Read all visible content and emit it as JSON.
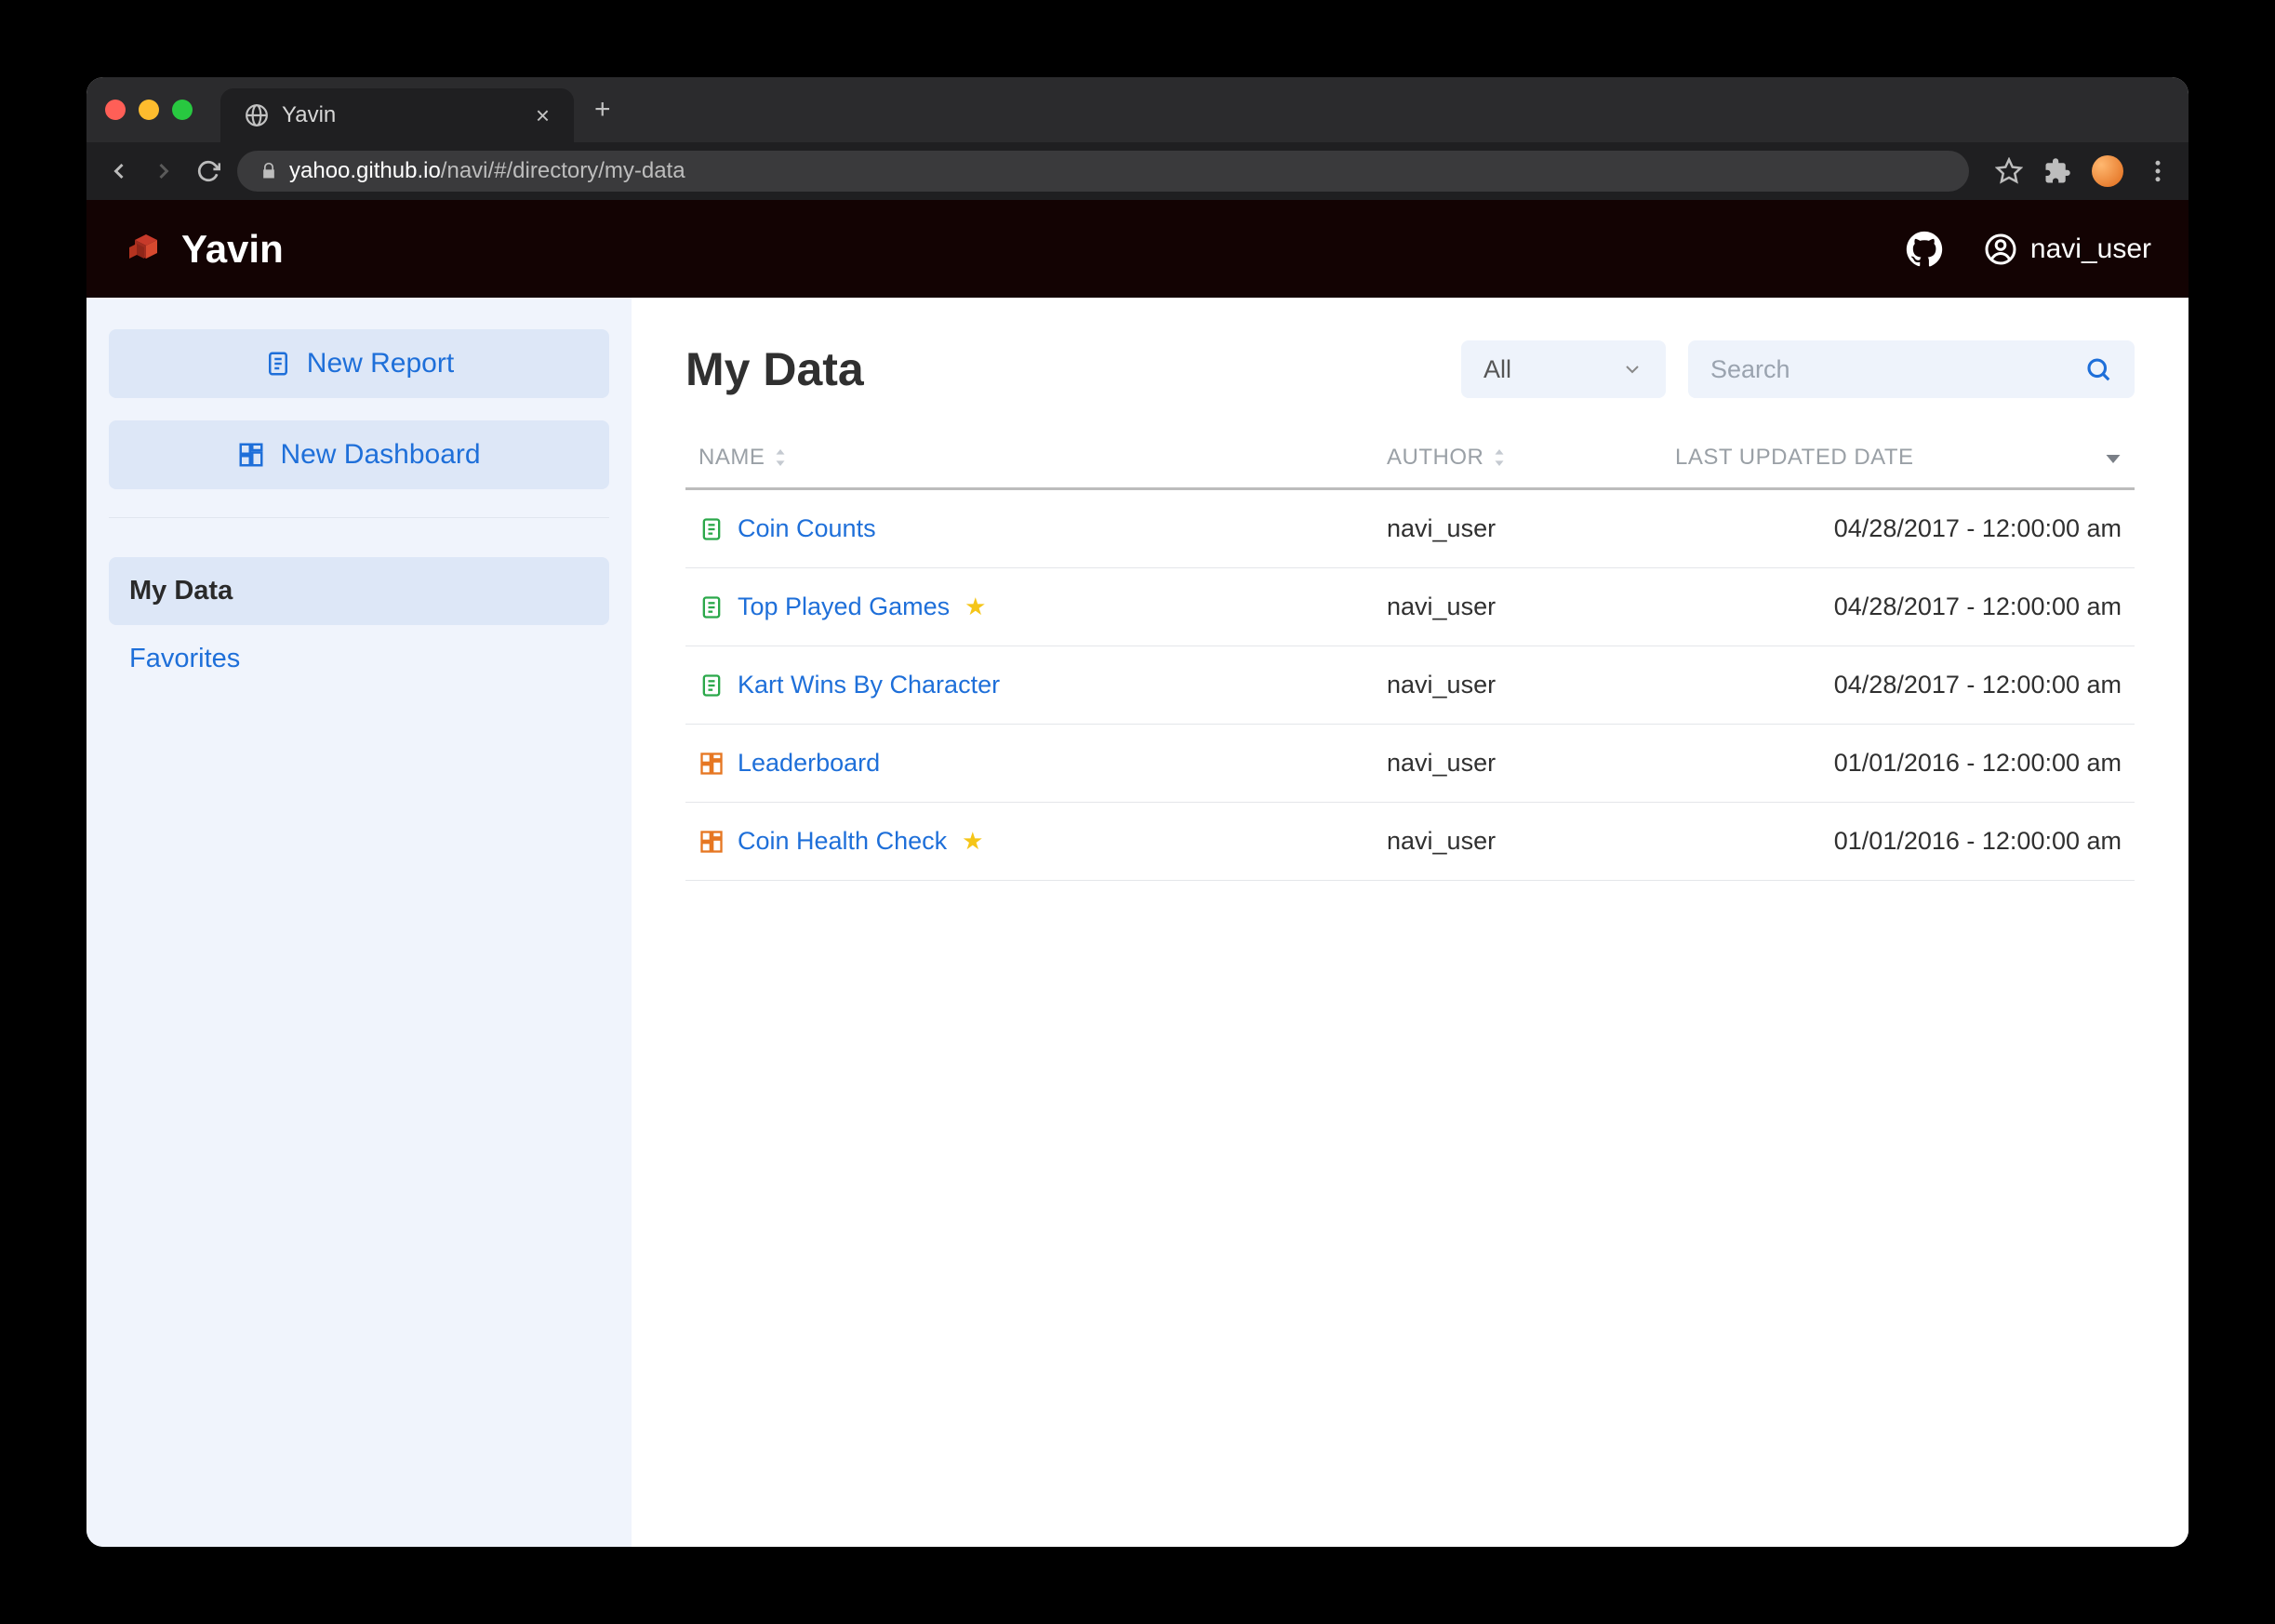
{
  "browser": {
    "tab_title": "Yavin",
    "url_domain": "yahoo.github.io",
    "url_path": "/navi/#/directory/my-data"
  },
  "header": {
    "brand": "Yavin",
    "username": "navi_user"
  },
  "sidebar": {
    "new_report_label": "New Report",
    "new_dashboard_label": "New Dashboard",
    "nav": [
      {
        "label": "My Data",
        "active": true
      },
      {
        "label": "Favorites",
        "active": false
      }
    ]
  },
  "main": {
    "title": "My Data",
    "filter_value": "All",
    "search_placeholder": "Search",
    "columns": {
      "name": "NAME",
      "author": "AUTHOR",
      "updated": "LAST UPDATED DATE"
    },
    "rows": [
      {
        "type": "report",
        "name": "Coin Counts",
        "fav": false,
        "author": "navi_user",
        "updated": "04/28/2017 - 12:00:00 am"
      },
      {
        "type": "report",
        "name": "Top Played Games",
        "fav": true,
        "author": "navi_user",
        "updated": "04/28/2017 - 12:00:00 am"
      },
      {
        "type": "report",
        "name": "Kart Wins By Character",
        "fav": false,
        "author": "navi_user",
        "updated": "04/28/2017 - 12:00:00 am"
      },
      {
        "type": "dashboard",
        "name": "Leaderboard",
        "fav": false,
        "author": "navi_user",
        "updated": "01/01/2016 - 12:00:00 am"
      },
      {
        "type": "dashboard",
        "name": "Coin Health Check",
        "fav": true,
        "author": "navi_user",
        "updated": "01/01/2016 - 12:00:00 am"
      }
    ]
  }
}
